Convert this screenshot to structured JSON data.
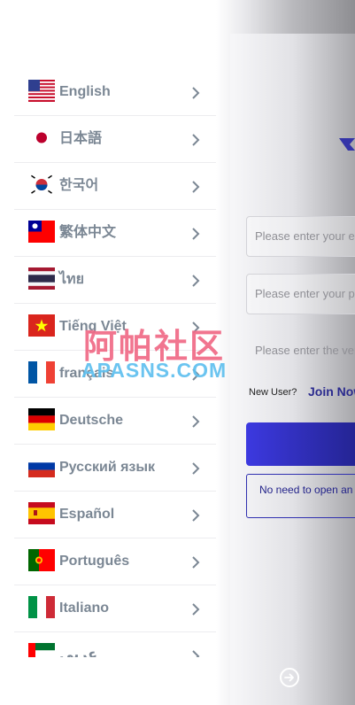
{
  "languages": [
    {
      "label": "English",
      "flag": "us-flag-icon"
    },
    {
      "label": "日本語",
      "flag": "japan-flag-icon"
    },
    {
      "label": "한국어",
      "flag": "korea-flag-icon"
    },
    {
      "label": "繁体中文",
      "flag": "taiwan-flag-icon"
    },
    {
      "label": "ไทย",
      "flag": "thailand-flag-icon"
    },
    {
      "label": "Tiếng Việt",
      "flag": "vietnam-flag-icon"
    },
    {
      "label": "français",
      "flag": "france-flag-icon"
    },
    {
      "label": "Deutsche",
      "flag": "germany-flag-icon"
    },
    {
      "label": "Русский язык",
      "flag": "russia-flag-icon"
    },
    {
      "label": "Español",
      "flag": "spain-flag-icon"
    },
    {
      "label": "Português",
      "flag": "portugal-flag-icon"
    },
    {
      "label": "Italiano",
      "flag": "italy-flag-icon"
    },
    {
      "label": "عربي",
      "flag": "uae-flag-icon"
    }
  ],
  "login": {
    "field1_placeholder": "Please enter your email",
    "field2_placeholder": "Please enter your password",
    "field3_placeholder": "Please enter the verification code",
    "new_user": "New User?",
    "join_now": "Join Now",
    "notice": "No need to open an account"
  },
  "watermark": {
    "cn": "阿帕社区",
    "en": "APASNS.COM"
  },
  "colors": {
    "accent": "#2a2a8e",
    "button_gradient_start": "#3c39e0",
    "label_gray": "#7b8794",
    "watermark_pink": "#f06a86",
    "watermark_blue": "#5fc0ef"
  }
}
